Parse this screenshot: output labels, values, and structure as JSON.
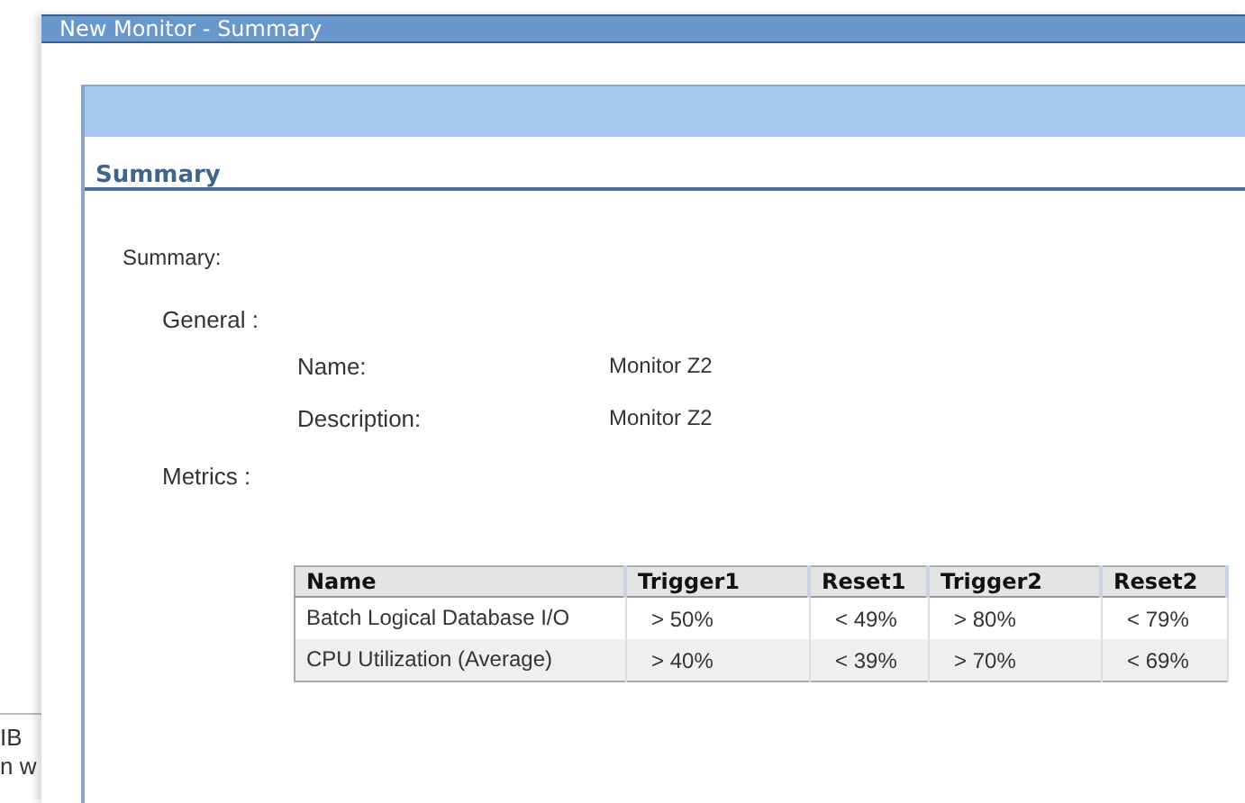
{
  "background": {
    "texts": [
      "IB",
      "n w"
    ]
  },
  "window": {
    "title": "New Monitor - Summary"
  },
  "section": {
    "heading": "Summary"
  },
  "summary": {
    "label": "Summary:",
    "general": {
      "label": "General :",
      "fields": [
        {
          "label": "Name:",
          "value": "Monitor Z2"
        },
        {
          "label": "Description:",
          "value": "Monitor Z2"
        }
      ]
    },
    "metrics": {
      "label": "Metrics :"
    }
  },
  "table": {
    "columns": [
      "Name",
      "Trigger1",
      "Reset1",
      "Trigger2",
      "Reset2"
    ],
    "rows": [
      [
        "Batch Logical Database I/O",
        "> 50%",
        "< 49%",
        "> 80%",
        "< 79%"
      ],
      [
        "CPU Utilization (Average)",
        "> 40%",
        "< 39%",
        "> 70%",
        "< 69%"
      ]
    ]
  }
}
